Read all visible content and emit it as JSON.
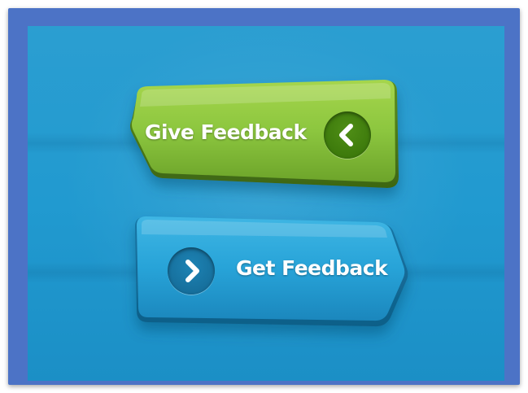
{
  "buttons": {
    "give_feedback": {
      "label": "Give Feedback",
      "icon": "chevron-left-icon",
      "color": "#8cc63f"
    },
    "get_feedback": {
      "label": "Get Feedback",
      "icon": "chevron-right-icon",
      "color": "#29a3d6"
    }
  },
  "colors": {
    "frame": "#4c73c6",
    "background": "#219ad0",
    "text": "#ffffff"
  }
}
